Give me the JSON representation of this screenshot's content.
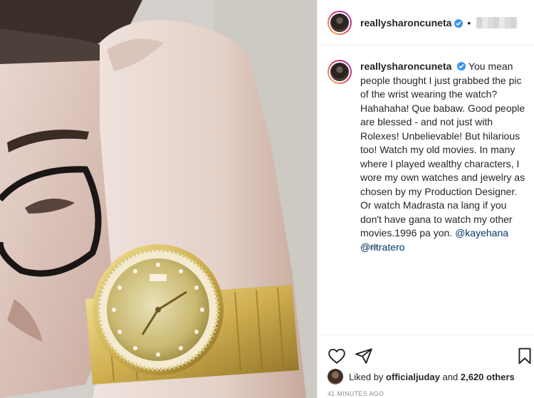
{
  "header": {
    "username": "reallysharoncuneta",
    "separator": "•",
    "verified_icon": "verified-badge-icon"
  },
  "caption": {
    "username": "reallysharoncuneta",
    "text": "You mean people thought I just grabbed the pic of the wrist wearing the watch? Hahahaha! Que babaw. Good people are blessed - and not just with Rolexes! Unbelievable! But hilarious too! Watch my old movies. In many where I played wealthy characters, I wore my own watches and jewelry as chosen by my Production Designer. Or watch Madrasta na lang if you don't have gana to watch my other movies.1996 pa yon.",
    "mention1": "@kayehana",
    "mention2": "@ritratero",
    "time": "41m"
  },
  "actions": {
    "like_icon": "heart-icon",
    "share_icon": "paper-plane-icon",
    "save_icon": "bookmark-icon"
  },
  "likes": {
    "prefix": "Liked by",
    "liker": "officialjuday",
    "and_label": "and",
    "others": "2,620 others"
  },
  "posted": "41 MINUTES AGO",
  "colors": {
    "link": "#00376b",
    "verified": "#3897f0",
    "muted": "#8e8e8e"
  }
}
